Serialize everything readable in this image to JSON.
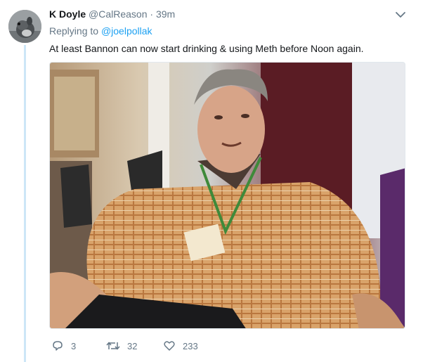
{
  "tweet": {
    "author": {
      "display_name": "K Doyle",
      "handle": "@CalReason",
      "separator": "·",
      "time": "39m",
      "avatar_icon": "squirrel-avatar"
    },
    "reply": {
      "prefix": "Replying to",
      "mention": "@joelpollak"
    },
    "text": "At least Bannon can now start drinking & using Meth before Noon again.",
    "media": {
      "type": "photo",
      "description_icon": "photo"
    },
    "actions": {
      "reply_count": "3",
      "retweet_count": "32",
      "like_count": "233"
    },
    "colors": {
      "link": "#1da1f2",
      "muted": "#657786",
      "thread_line": "#cde6f7",
      "text": "#14171a"
    }
  }
}
